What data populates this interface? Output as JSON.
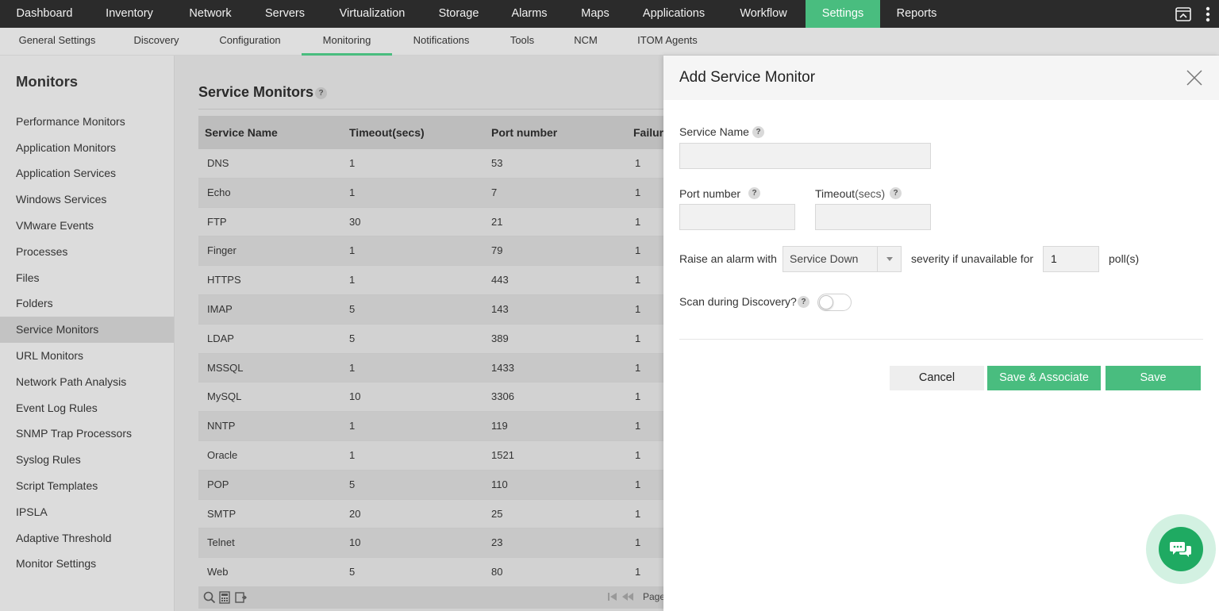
{
  "topnav": {
    "tabs": [
      "Dashboard",
      "Inventory",
      "Network",
      "Servers",
      "Virtualization",
      "Storage",
      "Alarms",
      "Maps",
      "Applications",
      "Workflow",
      "Settings",
      "Reports"
    ],
    "active": "Settings",
    "icons": [
      "screen-share-icon",
      "more-vertical-icon"
    ]
  },
  "subnav": {
    "tabs": [
      "General Settings",
      "Discovery",
      "Configuration",
      "Monitoring",
      "Notifications",
      "Tools",
      "NCM",
      "ITOM Agents"
    ],
    "active": "Monitoring"
  },
  "sidebar": {
    "title": "Monitors",
    "items": [
      "Performance Monitors",
      "Application Monitors",
      "Application Services",
      "Windows Services",
      "VMware Events",
      "Processes",
      "Files",
      "Folders",
      "Service Monitors",
      "URL Monitors",
      "Network Path Analysis",
      "Event Log Rules",
      "SNMP Trap Processors",
      "Syslog Rules",
      "Script Templates",
      "IPSLA",
      "Adaptive Threshold",
      "Monitor Settings"
    ],
    "active": "Service Monitors"
  },
  "main": {
    "title": "Service Monitors",
    "help": "?",
    "columns": [
      "Service Name",
      "Timeout(secs)",
      "Port number",
      "Failure"
    ],
    "rows": [
      [
        "DNS",
        "1",
        "53",
        "1"
      ],
      [
        "Echo",
        "1",
        "7",
        "1"
      ],
      [
        "FTP",
        "30",
        "21",
        "1"
      ],
      [
        "Finger",
        "1",
        "79",
        "1"
      ],
      [
        "HTTPS",
        "1",
        "443",
        "1"
      ],
      [
        "IMAP",
        "5",
        "143",
        "1"
      ],
      [
        "LDAP",
        "5",
        "389",
        "1"
      ],
      [
        "MSSQL",
        "1",
        "1433",
        "1"
      ],
      [
        "MySQL",
        "10",
        "3306",
        "1"
      ],
      [
        "NNTP",
        "1",
        "119",
        "1"
      ],
      [
        "Oracle",
        "1",
        "1521",
        "1"
      ],
      [
        "POP",
        "5",
        "110",
        "1"
      ],
      [
        "SMTP",
        "20",
        "25",
        "1"
      ],
      [
        "Telnet",
        "10",
        "23",
        "1"
      ],
      [
        "Web",
        "5",
        "80",
        "1"
      ]
    ],
    "footer_page_label": "Page"
  },
  "dialog": {
    "title": "Add Service Monitor",
    "service_name_label": "Service Name",
    "service_name_value": "",
    "port_label": "Port number",
    "port_value": "",
    "timeout_label": "Timeout",
    "timeout_unit": "(secs)",
    "timeout_value": "",
    "alarm_prefix": "Raise an alarm with",
    "severity_value": "Service Down",
    "alarm_middle": "severity if unavailable for",
    "polls_value": "1",
    "polls_suffix": "poll(s)",
    "scan_label": "Scan during Discovery?",
    "scan_enabled": false,
    "help": "?",
    "cancel_label": "Cancel",
    "save_associate_label": "Save & Associate",
    "save_label": "Save"
  },
  "colors": {
    "accent": "#49bd7f",
    "topbar": "#2b2b2b",
    "chat": "#1faa62"
  }
}
